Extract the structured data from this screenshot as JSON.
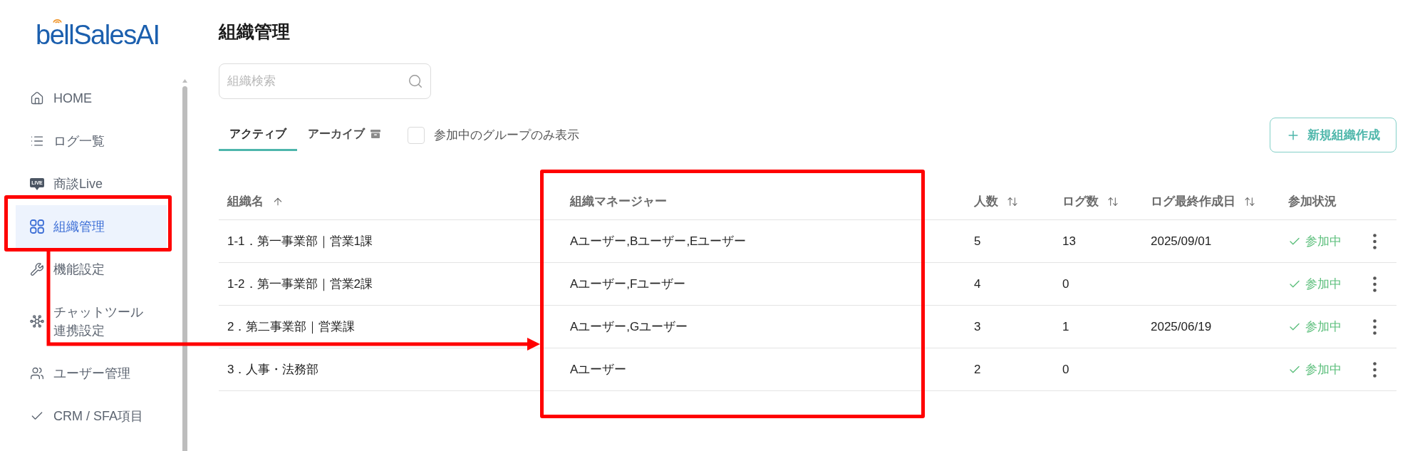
{
  "logo": {
    "text": "bellSalesAI"
  },
  "sidebar": {
    "items": [
      {
        "label": "HOME",
        "selected": false
      },
      {
        "label": "ログ一覧",
        "selected": false
      },
      {
        "label": "商談Live",
        "badge": "LIVE",
        "selected": false
      },
      {
        "label": "組織管理",
        "selected": true
      },
      {
        "label": "機能設定",
        "selected": false
      },
      {
        "label": "チャットツール連携設定",
        "selected": false
      },
      {
        "label": "ユーザー管理",
        "selected": false
      },
      {
        "label": "CRM / SFA項目",
        "selected": false
      }
    ]
  },
  "page_title": "組織管理",
  "search": {
    "placeholder": "組織検索"
  },
  "tabs": [
    {
      "label": "アクティブ",
      "selected": true
    },
    {
      "label": "アーカイブ",
      "selected": false
    }
  ],
  "filter": {
    "label": "参加中のグループのみ表示",
    "checked": false
  },
  "new_button": {
    "label": "新規組織作成"
  },
  "table": {
    "columns": [
      {
        "label": "組織名",
        "kind": "sorted"
      },
      {
        "label": "組織マネージャー",
        "kind": "plain"
      },
      {
        "label": "人数",
        "kind": "sortable"
      },
      {
        "label": "ログ数",
        "kind": "sortable"
      },
      {
        "label": "ログ最終作成日",
        "kind": "sortable"
      },
      {
        "label": "参加状況",
        "kind": "plain"
      }
    ],
    "rows": [
      {
        "name": "1-1．第一事業部｜営業1課",
        "managers": "Aユーザー,Bユーザー,Eユーザー",
        "members": "5",
        "logs": "13",
        "last_log": "2025/09/01",
        "status": "参加中",
        "joined": true
      },
      {
        "name": "1-2．第一事業部｜営業2課",
        "managers": "Aユーザー,Fユーザー",
        "members": "4",
        "logs": "0",
        "status": "参加中",
        "joined": true
      },
      {
        "name": "2．第二事業部｜営業課",
        "managers": "Aユーザー,Gユーザー",
        "members": "3",
        "logs": "1",
        "last_log": "2025/06/19",
        "status": "参加中",
        "joined": true
      },
      {
        "name": "3．人事・法務部",
        "managers": "Aユーザー",
        "members": "2",
        "logs": "0",
        "status": "参加中",
        "joined": true
      }
    ]
  },
  "annotations": [
    {
      "kind": "frame"
    },
    {
      "kind": "frame"
    },
    {
      "kind": "arrow"
    }
  ]
}
